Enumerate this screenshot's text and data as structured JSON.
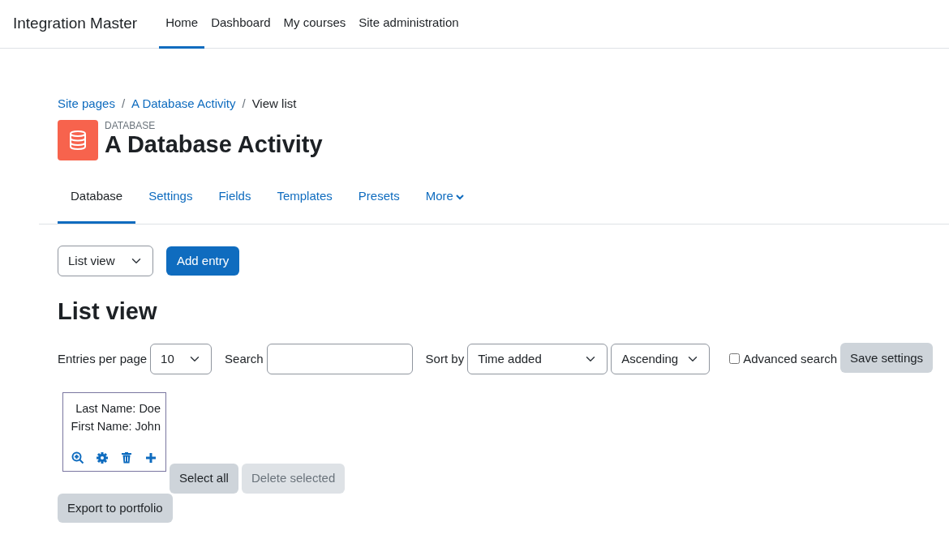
{
  "site_name": "Integration Master",
  "primary_nav": [
    {
      "label": "Home",
      "selected": true
    },
    {
      "label": "Dashboard",
      "selected": false
    },
    {
      "label": "My courses",
      "selected": false
    },
    {
      "label": "Site administration",
      "selected": false
    }
  ],
  "breadcrumb": {
    "separator": "/",
    "items": [
      "Site pages",
      "A Database Activity",
      "View list"
    ]
  },
  "activity": {
    "type_label": "DATABASE",
    "title": "A Database Activity"
  },
  "secondary_nav": [
    {
      "label": "Database",
      "selected": true,
      "kind": "link"
    },
    {
      "label": "Settings",
      "selected": false,
      "kind": "link"
    },
    {
      "label": "Fields",
      "selected": false,
      "kind": "link"
    },
    {
      "label": "Templates",
      "selected": false,
      "kind": "link"
    },
    {
      "label": "Presets",
      "selected": false,
      "kind": "link"
    },
    {
      "label": "More",
      "selected": false,
      "kind": "dropdown"
    }
  ],
  "view_select": {
    "value": "List view"
  },
  "add_entry_button": "Add entry",
  "heading": "List view",
  "filters": {
    "entries_label": "Entries per page",
    "entries_value": "10",
    "search_label": "Search",
    "sort_label": "Sort by",
    "sort_value": "Time added",
    "order_value": "Ascending",
    "advanced_search": {
      "label": "Advanced search",
      "checked": false
    },
    "save_button": "Save settings"
  },
  "entries": [
    {
      "lines": [
        "Last Name: Doe",
        "First Name: John"
      ]
    }
  ],
  "actions": [
    {
      "label": "Select all",
      "disabled": false
    },
    {
      "label": "Delete selected",
      "disabled": true
    }
  ],
  "export_button": "Export to portfolio"
}
